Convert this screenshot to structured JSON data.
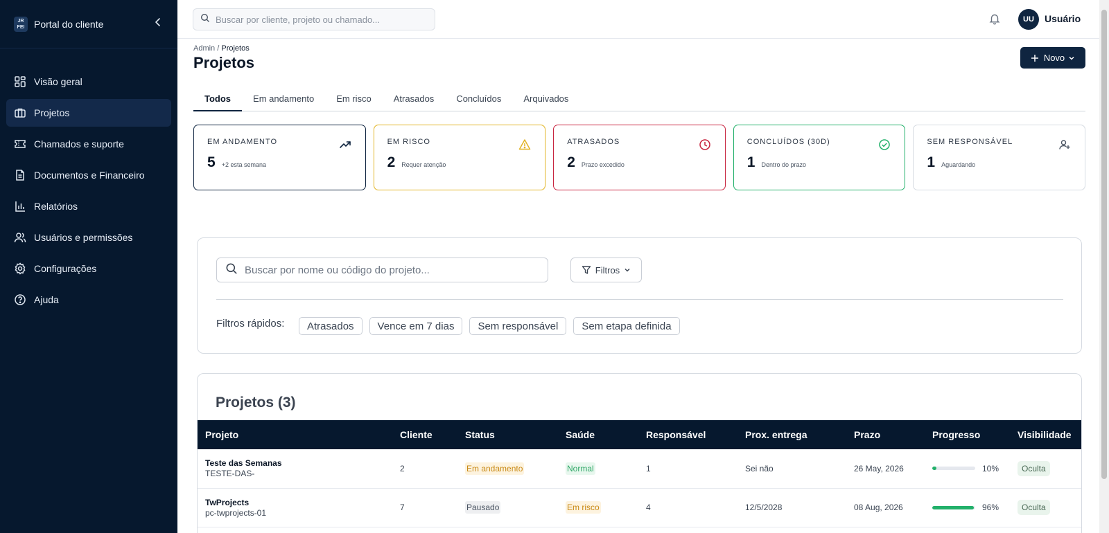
{
  "sidebar": {
    "brand_logo": "JR FEI",
    "brand_name": "Portal do cliente",
    "items": [
      {
        "label": "Visão geral",
        "icon": "grid-icon"
      },
      {
        "label": "Projetos",
        "icon": "briefcase-icon",
        "active": true
      },
      {
        "label": "Chamados e suporte",
        "icon": "ticket-icon"
      },
      {
        "label": "Documentos e Financeiro",
        "icon": "document-icon"
      },
      {
        "label": "Relatórios",
        "icon": "bar-chart-icon"
      },
      {
        "label": "Usuários e permissões",
        "icon": "users-icon"
      },
      {
        "label": "Configurações",
        "icon": "gear-icon"
      },
      {
        "label": "Ajuda",
        "icon": "help-icon"
      }
    ]
  },
  "header": {
    "search_placeholder": "Buscar por cliente, projeto ou chamado...",
    "avatar_initials": "UU",
    "username": "Usuário"
  },
  "page": {
    "breadcrumb_root": "Admin",
    "breadcrumb_sep": " / ",
    "breadcrumb_current": "Projetos",
    "title": "Projetos",
    "new_button": "Novo"
  },
  "tabs": [
    {
      "label": "Todos",
      "active": true
    },
    {
      "label": "Em andamento"
    },
    {
      "label": "Em risco"
    },
    {
      "label": "Atrasados"
    },
    {
      "label": "Concluídos"
    },
    {
      "label": "Arquivados"
    }
  ],
  "cards": [
    {
      "label": "EM ANDAMENTO",
      "value": "5",
      "sub": "+2 esta semana",
      "color": "#0f2540",
      "icon": "trend-up-icon"
    },
    {
      "label": "EM RISCO",
      "value": "2",
      "sub": "Requer atenção",
      "color": "#e2b424",
      "icon": "warning-icon"
    },
    {
      "label": "ATRASADOS",
      "value": "2",
      "sub": "Prazo excedido",
      "color": "#c8243f",
      "icon": "clock-icon"
    },
    {
      "label": "CONCLUÍDOS (30D)",
      "value": "1",
      "sub": "Dentro do prazo",
      "color": "#22b06a",
      "icon": "check-circle-icon"
    },
    {
      "label": "SEM RESPONSÁVEL",
      "value": "1",
      "sub": "Aguardando",
      "color": "#d6dbe2",
      "icon": "user-plus-icon"
    }
  ],
  "filters": {
    "search_placeholder": "Buscar por nome ou código do projeto...",
    "filter_button": "Filtros",
    "quick_label": "Filtros rápidos:",
    "chips": [
      "Atrasados",
      "Vence em 7 dias",
      "Sem responsável",
      "Sem etapa definida"
    ]
  },
  "table": {
    "title": "Projetos (3)",
    "columns": [
      "Projeto",
      "Cliente",
      "Status",
      "Saúde",
      "Responsável",
      "Prox. entrega",
      "Prazo",
      "Progresso",
      "Visibilidade"
    ],
    "rows": [
      {
        "name": "Teste das Semanas",
        "code": "TESTE-DAS-",
        "client": "2",
        "status": "Em andamento",
        "health": "Normal",
        "owner": "1",
        "next": "Sei não",
        "deadline": "26 May, 2026",
        "progress": 10,
        "progress_label": "10%",
        "visibility": "Oculta"
      },
      {
        "name": "TwProjects",
        "code": "pc-twprojects-01",
        "client": "7",
        "status": "Pausado",
        "health": "Em risco",
        "owner": "4",
        "next": "12/5/2028",
        "deadline": "08 Aug, 2026",
        "progress": 96,
        "progress_label": "96%",
        "visibility": "Oculta"
      }
    ]
  },
  "colors": {
    "sidebar_bg": "#06182e",
    "accent": "#0f2540",
    "progress": "#22b06a"
  }
}
